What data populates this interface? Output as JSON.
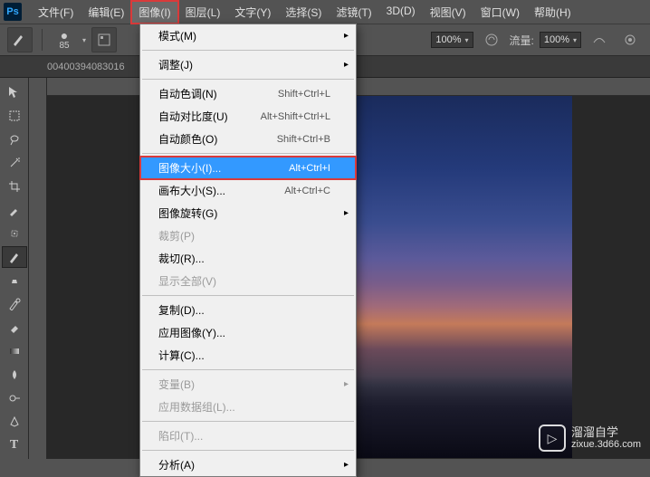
{
  "app": {
    "logo": "Ps"
  },
  "menubar": [
    {
      "label": "文件(F)"
    },
    {
      "label": "编辑(E)"
    },
    {
      "label": "图像(I)",
      "active": true
    },
    {
      "label": "图层(L)"
    },
    {
      "label": "文字(Y)"
    },
    {
      "label": "选择(S)"
    },
    {
      "label": "滤镜(T)"
    },
    {
      "label": "3D(D)"
    },
    {
      "label": "视图(V)"
    },
    {
      "label": "窗口(W)"
    },
    {
      "label": "帮助(H)"
    }
  ],
  "optbar": {
    "brush_size": "85",
    "opacity_label": "100%",
    "flow_label": "流量:",
    "flow_value": "100%"
  },
  "tab": {
    "title": "00400394083016"
  },
  "dropdown": [
    {
      "type": "item",
      "label": "模式(M)",
      "sub": true
    },
    {
      "type": "sep"
    },
    {
      "type": "item",
      "label": "调整(J)",
      "sub": true
    },
    {
      "type": "sep"
    },
    {
      "type": "item",
      "label": "自动色调(N)",
      "shortcut": "Shift+Ctrl+L"
    },
    {
      "type": "item",
      "label": "自动对比度(U)",
      "shortcut": "Alt+Shift+Ctrl+L"
    },
    {
      "type": "item",
      "label": "自动颜色(O)",
      "shortcut": "Shift+Ctrl+B"
    },
    {
      "type": "sep"
    },
    {
      "type": "item",
      "label": "图像大小(I)...",
      "shortcut": "Alt+Ctrl+I",
      "highlighted": true
    },
    {
      "type": "item",
      "label": "画布大小(S)...",
      "shortcut": "Alt+Ctrl+C"
    },
    {
      "type": "item",
      "label": "图像旋转(G)",
      "sub": true
    },
    {
      "type": "item",
      "label": "裁剪(P)",
      "disabled": true
    },
    {
      "type": "item",
      "label": "裁切(R)..."
    },
    {
      "type": "item",
      "label": "显示全部(V)",
      "disabled": true
    },
    {
      "type": "sep"
    },
    {
      "type": "item",
      "label": "复制(D)..."
    },
    {
      "type": "item",
      "label": "应用图像(Y)..."
    },
    {
      "type": "item",
      "label": "计算(C)..."
    },
    {
      "type": "sep"
    },
    {
      "type": "item",
      "label": "变量(B)",
      "sub": true,
      "disabled": true
    },
    {
      "type": "item",
      "label": "应用数据组(L)...",
      "disabled": true
    },
    {
      "type": "sep"
    },
    {
      "type": "item",
      "label": "陷印(T)...",
      "disabled": true
    },
    {
      "type": "sep"
    },
    {
      "type": "item",
      "label": "分析(A)",
      "sub": true
    }
  ],
  "watermark": {
    "brand": "溜溜自学",
    "url": "zixue.3d66.com"
  }
}
